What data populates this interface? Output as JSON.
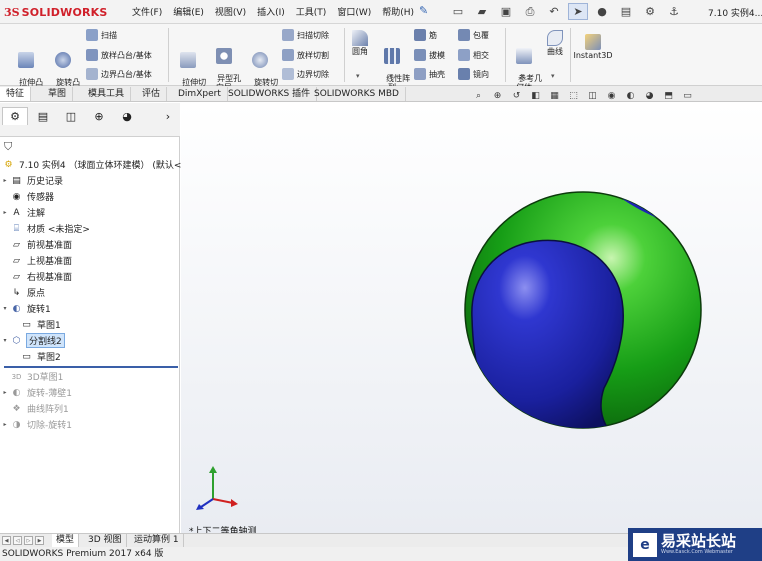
{
  "app": {
    "brand_prefix": "3S",
    "brand": "SOLIDWORKS",
    "document_title": "7.10 实例4..."
  },
  "menu": [
    "文件(F)",
    "编辑(E)",
    "视图(V)",
    "插入(I)",
    "工具(T)",
    "窗口(W)",
    "帮助(H)"
  ],
  "ribbon": {
    "extrude_boss": "拉伸凸\n台/基体",
    "revolve_boss": "旋转凸\n台/基体",
    "sweep": "扫描",
    "loft_boss": "放样凸台/基体",
    "boundary_boss": "边界凸台/基体",
    "extrude_cut": "拉伸切\n除",
    "hole_wizard": "异型孔\n向导",
    "revolve_cut": "旋转切\n除",
    "swept_cut": "扫描切除",
    "lofted_cut": "放样切割",
    "boundary_cut": "边界切除",
    "fillet": "圆角",
    "linear_pattern": "线性阵\n列",
    "rib": "筋",
    "draft": "拔模",
    "shell": "抽壳",
    "wrap": "包覆",
    "intersect": "相交",
    "mirror": "镜向",
    "ref_geometry": "参考几\n何体",
    "curves": "曲线",
    "instant3d": "Instant3D"
  },
  "tabs": [
    "特征",
    "草图",
    "模具工具",
    "评估",
    "DimXpert",
    "SOLIDWORKS 插件",
    "SOLIDWORKS MBD"
  ],
  "tree": {
    "root": "7.10 实例4 （球面立体环建模）  (默认<<",
    "items": [
      {
        "label": "历史记录"
      },
      {
        "label": "传感器"
      },
      {
        "label": "注解"
      },
      {
        "label": "材质 <未指定>"
      },
      {
        "label": "前视基准面"
      },
      {
        "label": "上视基准面"
      },
      {
        "label": "右视基准面"
      },
      {
        "label": "原点"
      },
      {
        "label": "旋转1"
      },
      {
        "label": "草图1"
      },
      {
        "label": "分割线2"
      },
      {
        "label": "草图2"
      },
      {
        "label": "3D草图1"
      },
      {
        "label": "旋转-薄壁1"
      },
      {
        "label": "曲线阵列1"
      },
      {
        "label": "切除-旋转1"
      }
    ]
  },
  "viewport": {
    "view_label": "*上下二等角轴测",
    "sphere_colors": {
      "outer": "#1fa31f",
      "inner": "#1c24b5"
    }
  },
  "bottom_tabs": [
    "模型",
    "3D 视图",
    "运动算例 1"
  ],
  "status": "SOLIDWORKS Premium 2017 x64 版",
  "watermark": {
    "title": "易采站长站",
    "subtitle": "Www.Easck.Com Webmaster"
  }
}
